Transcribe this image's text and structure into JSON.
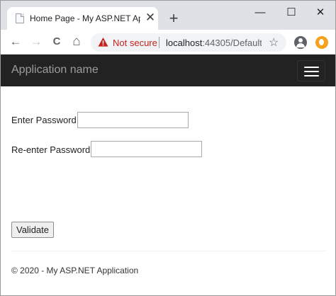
{
  "browser": {
    "tab": {
      "title": "Home Page - My ASP.NET Applic",
      "favicon": "page-icon",
      "close": "✕"
    },
    "new_tab": "+",
    "window_controls": {
      "minimize": "—",
      "maximize": "☐",
      "close": "✕"
    },
    "nav": {
      "back": "←",
      "forward": "→",
      "reload": "C",
      "home": "⌂"
    },
    "address_bar": {
      "security_label": "Not secure",
      "host": "localhost",
      "path": ":44305/Default",
      "warning_color": "#c5221f"
    },
    "bookmark_star": "☆"
  },
  "navbar": {
    "brand": "Application name",
    "menu_icon": "hamburger-menu-icon"
  },
  "form": {
    "password_label": "Enter Password",
    "password_value": "",
    "reenter_label": "Re-enter Password",
    "reenter_value": "",
    "validate_label": "Validate"
  },
  "footer": {
    "text": "© 2020 - My ASP.NET Application"
  },
  "colors": {
    "navbar_bg": "#222222",
    "brand_text": "#9d9d9d",
    "tabstrip_bg": "#dee1e6"
  }
}
